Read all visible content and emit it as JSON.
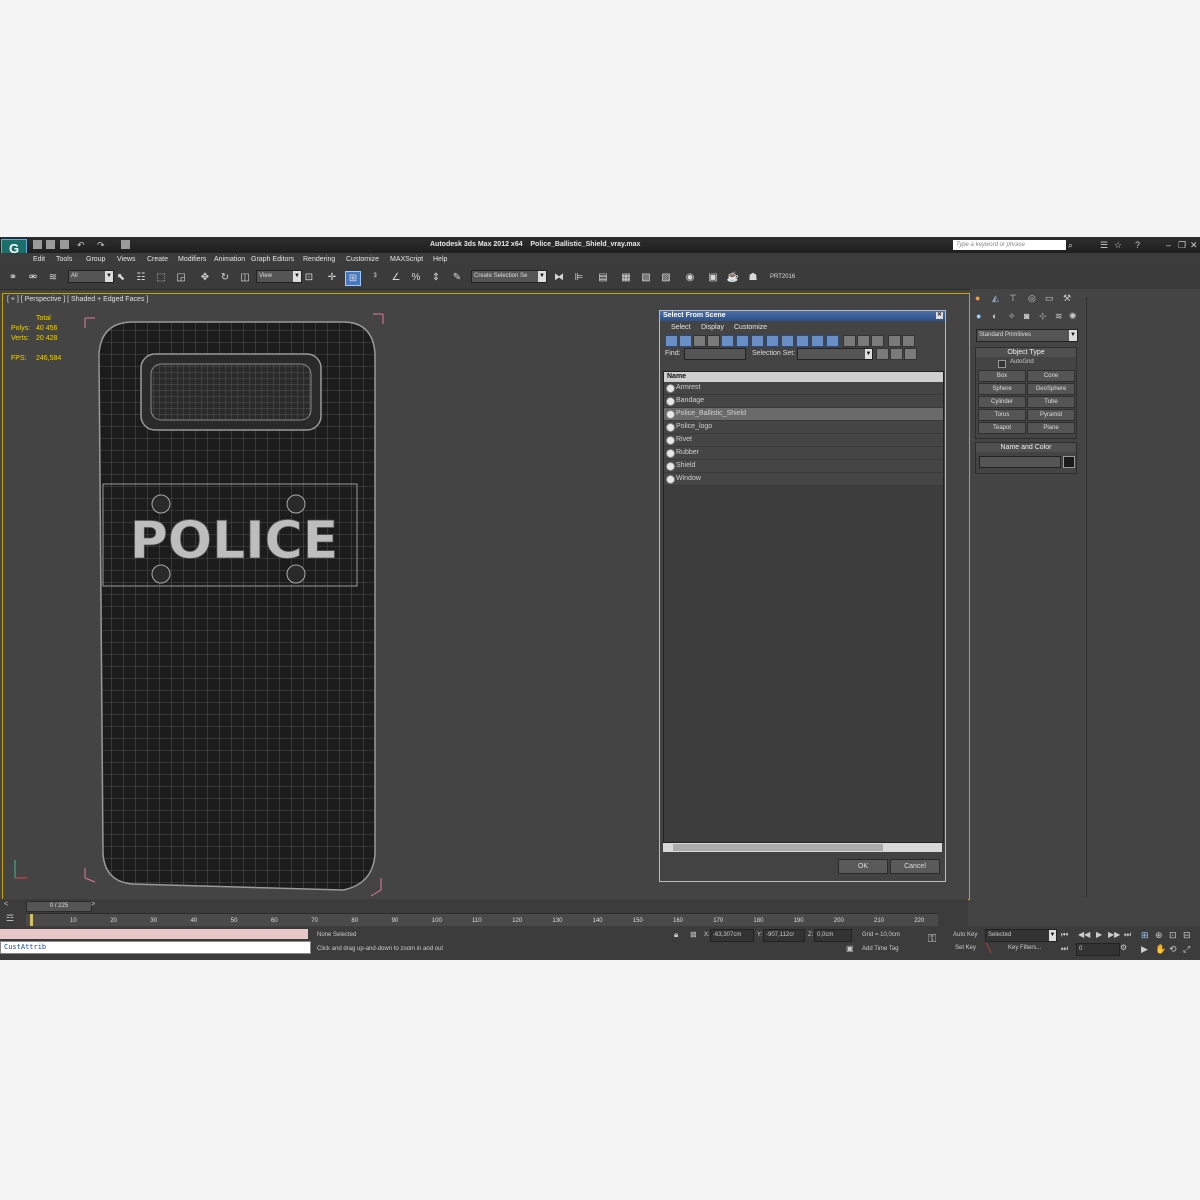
{
  "title": {
    "app": "Autodesk 3ds Max  2012 x64",
    "file": "Police_Ballistic_Shield_vray.max"
  },
  "search": {
    "placeholder": "Type a keyword or phrase"
  },
  "menu": [
    "Edit",
    "Tools",
    "Group",
    "Views",
    "Create",
    "Modifiers",
    "Animation",
    "Graph Editors",
    "Rendering",
    "Customize",
    "MAXScript",
    "Help"
  ],
  "toolbar": {
    "filter_value": "All",
    "view_value": "View",
    "selection_set": "Create Selection Se",
    "prt_label": "PRT2016"
  },
  "viewport": {
    "label": "[ + ] [ Perspective ] [ Shaded + Edged Faces ]",
    "stats": {
      "total_label": "Total",
      "polys_label": "Polys:",
      "polys": "40 456",
      "verts_label": "Verts:",
      "verts": "20 428",
      "fps_label": "FPS:",
      "fps": "246,584"
    },
    "shield_text": "POLICE"
  },
  "dialog": {
    "title": "Select From Scene",
    "menu": [
      "Select",
      "Display",
      "Customize"
    ],
    "find_label": "Find:",
    "selection_set_label": "Selection Set:",
    "column": "Name",
    "items": [
      "Armrest",
      "Bandage",
      "Police_Ballistic_Shield",
      "Police_logo",
      "Rivet",
      "Rubber",
      "Shield",
      "Window"
    ],
    "selected_index": 2,
    "ok": "OK",
    "cancel": "Cancel"
  },
  "command_panel": {
    "category": "Standard Primitives",
    "object_type": "Object Type",
    "autogrid": "AutoGrid",
    "primitives": [
      "Box",
      "Cone",
      "Sphere",
      "GeoSphere",
      "Cylinder",
      "Tube",
      "Torus",
      "Pyramid",
      "Teapot",
      "Plane"
    ],
    "name_and_color": "Name and Color",
    "color": "#1a1a1a"
  },
  "timeline": {
    "frame": "0 / 225",
    "ticks": [
      "10",
      "20",
      "30",
      "40",
      "50",
      "60",
      "70",
      "80",
      "90",
      "100",
      "110",
      "120",
      "130",
      "140",
      "150",
      "160",
      "170",
      "180",
      "190",
      "200",
      "210",
      "220"
    ]
  },
  "status": {
    "script": "CustAttrib",
    "selection": "None Selected",
    "prompt": "Click and drag up-and-down to zoom in and out",
    "x_label": "X:",
    "x": "-63,307cm",
    "y_label": "Y:",
    "y": "-907,112cr",
    "z_label": "Z:",
    "z": "0,0cm",
    "grid": "Grid = 10,0cm",
    "add_time_tag": "Add Time Tag",
    "auto_key": "Auto Key",
    "auto_key_mode": "Selected",
    "set_key": "Set Key",
    "key_filters": "Key Filters...",
    "current_frame": "0"
  }
}
